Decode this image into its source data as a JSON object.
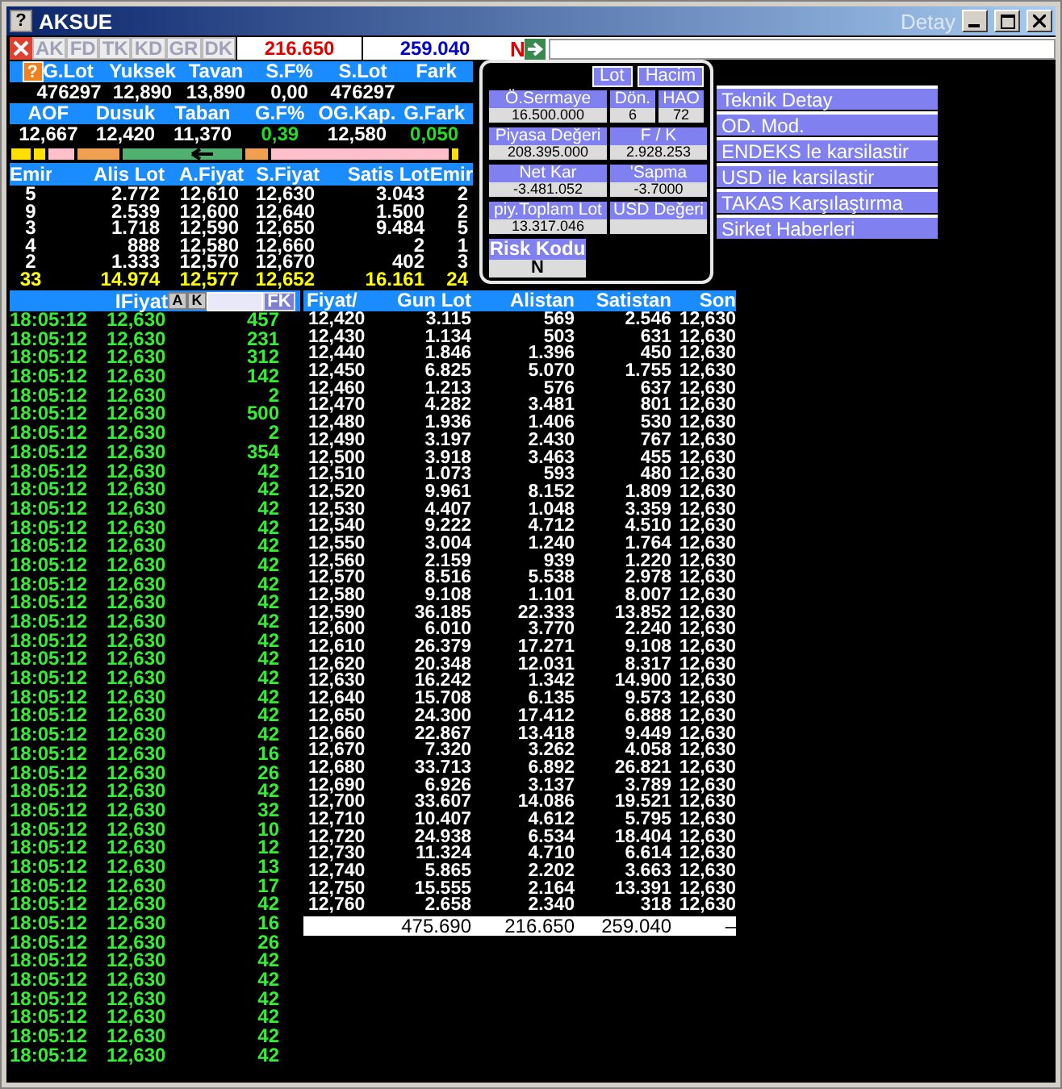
{
  "window": {
    "help": "?",
    "title": "AKSUE",
    "subtitle": "Detay"
  },
  "toolbar": {
    "tabs": [
      {
        "label": "AK",
        "disabled": true
      },
      {
        "label": "FD",
        "disabled": true
      },
      {
        "label": "TK",
        "disabled": true
      },
      {
        "label": "KD",
        "disabled": true
      },
      {
        "label": "GR",
        "disabled": true
      },
      {
        "label": "DK",
        "disabled": true
      }
    ],
    "buy_total": "216.650",
    "sell_total": "259.040",
    "flag": "N"
  },
  "summary": {
    "help": "?",
    "header_1": [
      "G.Lot",
      "Yuksek",
      "Tavan",
      "S.F%",
      "S.Lot",
      "Fark"
    ],
    "values_1": [
      {
        "text": "476297",
        "kind": "plain"
      },
      {
        "text": "12,890",
        "kind": "plain"
      },
      {
        "text": "13,890",
        "kind": "plain"
      },
      {
        "text": "0,00",
        "kind": "plain"
      },
      {
        "text": "476297",
        "kind": "plain"
      }
    ],
    "header_2": [
      "AOF",
      "Dusuk",
      "Taban",
      "G.F%",
      "OG.Kap.",
      "G.Fark"
    ],
    "values_2": [
      {
        "text": "12,667",
        "kind": "plain"
      },
      {
        "text": "12,420",
        "kind": "plain"
      },
      {
        "text": "11,370",
        "kind": "plain"
      },
      {
        "text": "0,39",
        "kind": "up"
      },
      {
        "text": "12,580",
        "kind": "plain"
      },
      {
        "text": "0,050",
        "kind": "up"
      }
    ]
  },
  "order_book": {
    "columns": [
      "Emir",
      "Alis Lot",
      "A.Fiyat",
      "S.Fiyat",
      "Satis Lot",
      "Emir"
    ],
    "rows": [
      [
        "5",
        "2.772",
        "12,610",
        "12,630",
        "3.043",
        "2"
      ],
      [
        "9",
        "2.539",
        "12,600",
        "12,640",
        "1.500",
        "2"
      ],
      [
        "3",
        "1.718",
        "12,590",
        "12,650",
        "9.484",
        "5"
      ],
      [
        "4",
        "888",
        "12,580",
        "12,660",
        "2",
        "1"
      ],
      [
        "2",
        "1.333",
        "12,570",
        "12,670",
        "402",
        "3"
      ]
    ],
    "totals": [
      "33",
      "14.974",
      "12,577",
      "12,652",
      "16.161",
      "24"
    ]
  },
  "panel": {
    "buttons": [
      "Lot",
      "Hacim"
    ],
    "rows": [
      [
        {
          "label": "Ö.Sermaye",
          "value": "16.500.000"
        },
        {
          "label": "Dön.",
          "value": "6"
        },
        {
          "label": "HAO",
          "value": "72"
        }
      ],
      [
        {
          "label": "Piyasa Değeri",
          "value": "208.395.000"
        },
        {
          "label": "F / K",
          "value": "2.928.253"
        }
      ],
      [
        {
          "label": "Net Kar",
          "value": "-3.481.052"
        },
        {
          "label": "'Sapma",
          "value": "-3.7000"
        }
      ],
      [
        {
          "label": "piy.Toplam Lot",
          "value": "13.317.046"
        },
        {
          "label": "USD Değeri"
        }
      ]
    ],
    "risk": {
      "label": "Risk Kodu",
      "value": "N"
    }
  },
  "menu": [
    "Teknik Detay",
    "OD. Mod.",
    "ENDEKS le karsilastir",
    "USD ile karsilastir",
    "TAKAS Karşılaştırma",
    "Sirket Haberleri"
  ],
  "trades": {
    "header": "IFiyat",
    "buttons": [
      "A",
      "K"
    ],
    "filter_button": "FK",
    "rows": [
      [
        "18:05:12",
        "12,630",
        "457"
      ],
      [
        "18:05:12",
        "12,630",
        "231"
      ],
      [
        "18:05:12",
        "12,630",
        "312"
      ],
      [
        "18:05:12",
        "12,630",
        "142"
      ],
      [
        "18:05:12",
        "12,630",
        "2"
      ],
      [
        "18:05:12",
        "12,630",
        "500"
      ],
      [
        "18:05:12",
        "12,630",
        "2"
      ],
      [
        "18:05:12",
        "12,630",
        "354"
      ],
      [
        "18:05:12",
        "12,630",
        "42"
      ],
      [
        "18:05:12",
        "12,630",
        "42"
      ],
      [
        "18:05:12",
        "12,630",
        "42"
      ],
      [
        "18:05:12",
        "12,630",
        "42"
      ],
      [
        "18:05:12",
        "12,630",
        "42"
      ],
      [
        "18:05:12",
        "12,630",
        "42"
      ],
      [
        "18:05:12",
        "12,630",
        "42"
      ],
      [
        "18:05:12",
        "12,630",
        "42"
      ],
      [
        "18:05:12",
        "12,630",
        "42"
      ],
      [
        "18:05:12",
        "12,630",
        "42"
      ],
      [
        "18:05:12",
        "12,630",
        "42"
      ],
      [
        "18:05:12",
        "12,630",
        "42"
      ],
      [
        "18:05:12",
        "12,630",
        "42"
      ],
      [
        "18:05:12",
        "12,630",
        "42"
      ],
      [
        "18:05:12",
        "12,630",
        "42"
      ],
      [
        "18:05:12",
        "12,630",
        "16"
      ],
      [
        "18:05:12",
        "12,630",
        "26"
      ],
      [
        "18:05:12",
        "12,630",
        "42"
      ],
      [
        "18:05:12",
        "12,630",
        "32"
      ],
      [
        "18:05:12",
        "12,630",
        "10"
      ],
      [
        "18:05:12",
        "12,630",
        "12"
      ],
      [
        "18:05:12",
        "12,630",
        "13"
      ],
      [
        "18:05:12",
        "12,630",
        "17"
      ],
      [
        "18:05:12",
        "12,630",
        "42"
      ],
      [
        "18:05:12",
        "12,630",
        "16"
      ],
      [
        "18:05:12",
        "12,630",
        "26"
      ],
      [
        "18:05:12",
        "12,630",
        "42"
      ],
      [
        "18:05:12",
        "12,630",
        "42"
      ],
      [
        "18:05:12",
        "12,630",
        "42"
      ],
      [
        "18:05:12",
        "12,630",
        "42"
      ],
      [
        "18:05:12",
        "12,630",
        "42"
      ],
      [
        "18:05:12",
        "12,630",
        "42"
      ]
    ]
  },
  "depth": {
    "columns": [
      "Fiyat/",
      "Gun Lot",
      "Alistan",
      "Satistan",
      "Son"
    ],
    "rows": [
      [
        "12,420",
        "3.115",
        "569",
        "2.546",
        "12,630"
      ],
      [
        "12,430",
        "1.134",
        "503",
        "631",
        "12,630"
      ],
      [
        "12,440",
        "1.846",
        "1.396",
        "450",
        "12,630"
      ],
      [
        "12,450",
        "6.825",
        "5.070",
        "1.755",
        "12,630"
      ],
      [
        "12,460",
        "1.213",
        "576",
        "637",
        "12,630"
      ],
      [
        "12,470",
        "4.282",
        "3.481",
        "801",
        "12,630"
      ],
      [
        "12,480",
        "1.936",
        "1.406",
        "530",
        "12,630"
      ],
      [
        "12,490",
        "3.197",
        "2.430",
        "767",
        "12,630"
      ],
      [
        "12,500",
        "3.918",
        "3.463",
        "455",
        "12,630"
      ],
      [
        "12,510",
        "1.073",
        "593",
        "480",
        "12,630"
      ],
      [
        "12,520",
        "9.961",
        "8.152",
        "1.809",
        "12,630"
      ],
      [
        "12,530",
        "4.407",
        "1.048",
        "3.359",
        "12,630"
      ],
      [
        "12,540",
        "9.222",
        "4.712",
        "4.510",
        "12,630"
      ],
      [
        "12,550",
        "3.004",
        "1.240",
        "1.764",
        "12,630"
      ],
      [
        "12,560",
        "2.159",
        "939",
        "1.220",
        "12,630"
      ],
      [
        "12,570",
        "8.516",
        "5.538",
        "2.978",
        "12,630"
      ],
      [
        "12,580",
        "9.108",
        "1.101",
        "8.007",
        "12,630"
      ],
      [
        "12,590",
        "36.185",
        "22.333",
        "13.852",
        "12,630"
      ],
      [
        "12,600",
        "6.010",
        "3.770",
        "2.240",
        "12,630"
      ],
      [
        "12,610",
        "26.379",
        "17.271",
        "9.108",
        "12,630"
      ],
      [
        "12,620",
        "20.348",
        "12.031",
        "8.317",
        "12,630"
      ],
      [
        "12,630",
        "16.242",
        "1.342",
        "14.900",
        "12,630"
      ],
      [
        "12,640",
        "15.708",
        "6.135",
        "9.573",
        "12,630"
      ],
      [
        "12,650",
        "24.300",
        "17.412",
        "6.888",
        "12,630"
      ],
      [
        "12,660",
        "22.867",
        "13.418",
        "9.449",
        "12,630"
      ],
      [
        "12,670",
        "7.320",
        "3.262",
        "4.058",
        "12,630"
      ],
      [
        "12,680",
        "33.713",
        "6.892",
        "26.821",
        "12,630"
      ],
      [
        "12,690",
        "6.926",
        "3.137",
        "3.789",
        "12,630"
      ],
      [
        "12,700",
        "33.607",
        "14.086",
        "19.521",
        "12,630"
      ],
      [
        "12,710",
        "10.407",
        "4.612",
        "5.795",
        "12,630"
      ],
      [
        "12,720",
        "24.938",
        "6.534",
        "18.404",
        "12,630"
      ],
      [
        "12,730",
        "11.324",
        "4.710",
        "6.614",
        "12,630"
      ],
      [
        "12,740",
        "5.865",
        "2.202",
        "3.663",
        "12,630"
      ],
      [
        "12,750",
        "15.555",
        "2.164",
        "13.391",
        "12,630"
      ],
      [
        "12,760",
        "2.658",
        "2.340",
        "318",
        "12,630"
      ]
    ],
    "totals": [
      "475.690",
      "216.650",
      "259.040",
      "–"
    ]
  }
}
